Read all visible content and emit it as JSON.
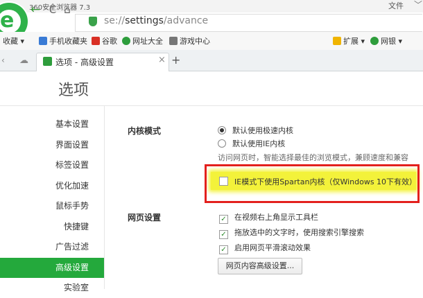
{
  "window": {
    "title": "360安全浏览器 7.3",
    "menu_file": "文件",
    "menu_chevron": "﹀"
  },
  "nav": {
    "back": "←",
    "refresh": "C",
    "home": "⌂",
    "url_scheme": "se://",
    "url_host": "settings",
    "url_path": "/advance"
  },
  "bookmarks": [
    {
      "label": "收藏",
      "color": "#e2a02a"
    },
    {
      "label": "手机收藏夹",
      "color": "#3a7bd5"
    },
    {
      "label": "谷歌",
      "color": "#d93025"
    },
    {
      "label": "网址大全",
      "color": "#2e9d3c"
    },
    {
      "label": "游戏中心",
      "color": "#777777"
    },
    {
      "label": "扩展",
      "color": "#f0b400"
    },
    {
      "label": "网银",
      "color": "#2e9d3c"
    }
  ],
  "tab": {
    "label": "选项 - 高级设置",
    "close": "×",
    "new": "+"
  },
  "page": {
    "title": "选项"
  },
  "sidebar": {
    "items": [
      {
        "label": "基本设置"
      },
      {
        "label": "界面设置"
      },
      {
        "label": "标签设置"
      },
      {
        "label": "优化加速"
      },
      {
        "label": "鼠标手势"
      },
      {
        "label": "快捷键"
      },
      {
        "label": "广告过滤"
      },
      {
        "label": "高级设置",
        "active": true
      },
      {
        "label": "实验室"
      }
    ]
  },
  "kernel": {
    "label": "内核模式",
    "options": [
      {
        "label": "默认使用极速内核",
        "selected": true
      },
      {
        "label": "默认使用IE内核",
        "selected": false
      }
    ],
    "description": "访问网页时，智能选择最佳的浏览模式，兼顾速度和兼容",
    "spartan_label": "IE模式下使用Spartan内核（仅Windows 10下有效）",
    "spartan_checked": false
  },
  "webpage": {
    "label": "网页设置",
    "options": [
      {
        "label": "在视频右上角显示工具栏",
        "checked": true
      },
      {
        "label": "拖放选中的文字时，使用搜索引擎搜索",
        "checked": true
      },
      {
        "label": "启用网页平滑滚动效果",
        "checked": true
      }
    ],
    "advanced_button": "网页内容高级设置..."
  },
  "colors": {
    "accent": "#24a93c",
    "highlight": "#f3f23a",
    "annotation": "#e3201d"
  }
}
